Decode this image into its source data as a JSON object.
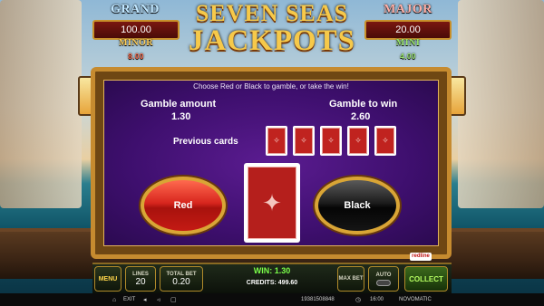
{
  "jackpots": {
    "grand": {
      "label": "GRAND",
      "value": "100.00"
    },
    "major": {
      "label": "MAJOR",
      "value": "20.00"
    },
    "minor": {
      "label": "MINOR",
      "value": "8.00"
    },
    "mini": {
      "label": "MINI",
      "value": "4.00"
    }
  },
  "logo": {
    "line1": "SEVEN SEAS",
    "line2": "JACKPOTS"
  },
  "gamble": {
    "instruction": "Choose Red or Black to gamble, or take the win!",
    "amount_label": "Gamble amount",
    "amount_value": "1.30",
    "to_win_label": "Gamble to win",
    "to_win_value": "2.60",
    "previous_label": "Previous cards",
    "red_label": "Red",
    "black_label": "Black"
  },
  "bottom_bar": {
    "menu": "MENU",
    "lines_label": "LINES",
    "lines_value": "20",
    "total_bet_label": "TOTAL BET",
    "total_bet_value": "0.20",
    "win_text": "WIN: 1.30",
    "credits_text": "CREDITS: 499.60",
    "max_bet": "MAX BET",
    "auto": "AUTO",
    "collect": "COLLECT"
  },
  "status_bar": {
    "exit": "EXIT",
    "session_id": "19381508848",
    "clock": "16:00",
    "brand": "NOVOMATIC",
    "provider_badge": "redline"
  },
  "colors": {
    "red_button": "#d8261e",
    "black_button": "#141414",
    "panel_purple": "#4a137f",
    "gold": "#d9a535"
  }
}
